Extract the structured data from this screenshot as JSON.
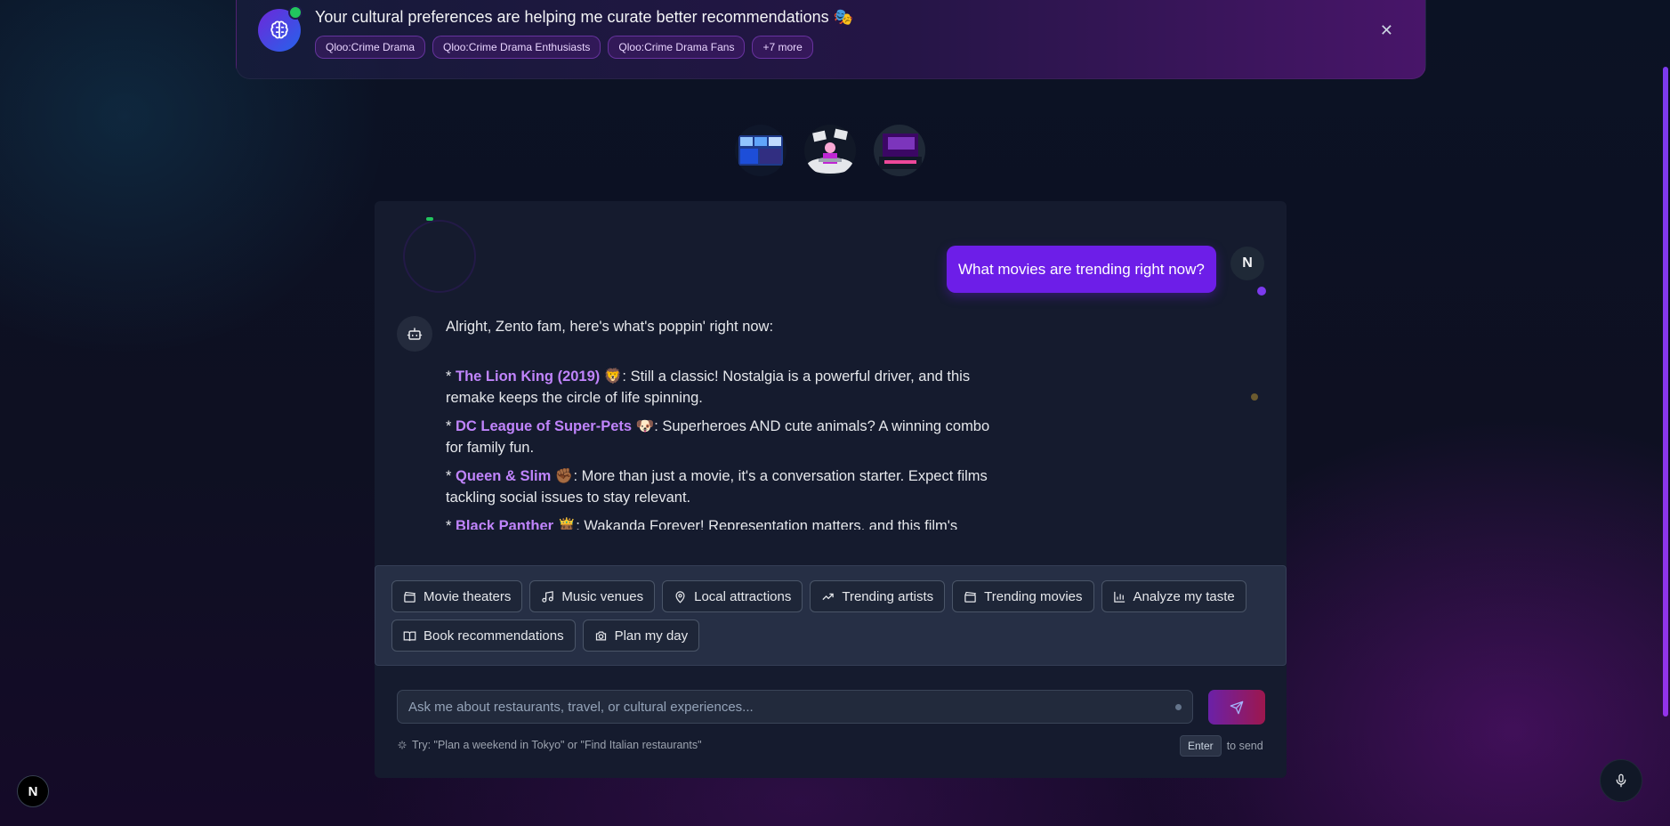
{
  "banner": {
    "title": "Your cultural preferences are helping me curate better recommendations 🎭",
    "chips": [
      "Qloo:Crime Drama",
      "Qloo:Crime Drama Enthusiasts",
      "Qloo:Crime Drama Fans",
      "+7 more"
    ]
  },
  "chat": {
    "user_message": "What movies are trending right now?",
    "user_initial": "N",
    "bot_intro": "Alright, Zento fam, here's what's poppin' right now:",
    "bot_items": [
      {
        "prefix": "* ",
        "title": "The Lion King (2019)",
        "emoji": " 🦁",
        "text": ": Still a classic! Nostalgia is a powerful driver, and this remake keeps the circle of life spinning."
      },
      {
        "prefix": "* ",
        "title": "DC League of Super-Pets",
        "emoji": " 🐶",
        "text": ": Superheroes AND cute animals? A winning combo for family fun."
      },
      {
        "prefix": "* ",
        "title": "Queen & Slim",
        "emoji": " ✊🏾",
        "text": ": More than just a movie, it's a conversation starter. Expect films tackling social issues to stay relevant."
      },
      {
        "prefix": "* ",
        "title": "Black Panther",
        "emoji": " 🤴🏾",
        "text": ": Wakanda Forever! Representation matters, and this film's"
      }
    ]
  },
  "quick_actions": [
    {
      "label": "Movie theaters",
      "icon": "clapperboard-icon"
    },
    {
      "label": "Music venues",
      "icon": "music-note-icon"
    },
    {
      "label": "Local attractions",
      "icon": "map-pin-icon"
    },
    {
      "label": "Trending artists",
      "icon": "trending-up-icon"
    },
    {
      "label": "Trending movies",
      "icon": "clapperboard-icon"
    },
    {
      "label": "Analyze my taste",
      "icon": "bar-chart-icon"
    },
    {
      "label": "Book recommendations",
      "icon": "book-open-icon"
    },
    {
      "label": "Plan my day",
      "icon": "camera-icon"
    }
  ],
  "input": {
    "placeholder": "Ask me about restaurants, travel, or cultural experiences..."
  },
  "hint": "Try: \"Plan a weekend in Tokyo\" or \"Find Italian restaurants\"",
  "send_hint": {
    "key": "Enter",
    "text": "to send"
  },
  "dev_badge": "N",
  "colors": {
    "accent": "#6d1ee8",
    "highlight": "#c084fc",
    "card": "#151b2e"
  }
}
